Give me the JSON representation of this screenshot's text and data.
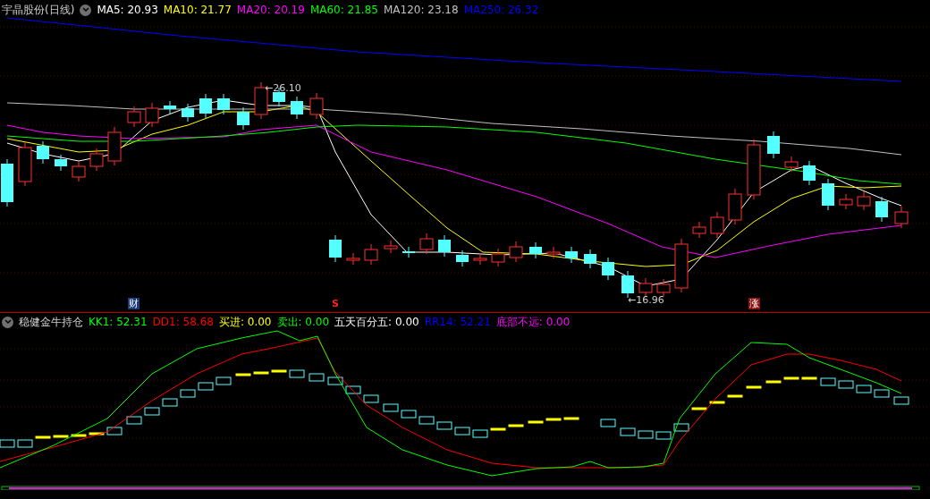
{
  "main_chart": {
    "title": "宇晶股份(日线)",
    "legend": [
      {
        "label": "MA5: 20.93",
        "color": "#ffffff"
      },
      {
        "label": "MA10: 21.77",
        "color": "#ffff00"
      },
      {
        "label": "MA20: 20.19",
        "color": "#ff00ff"
      },
      {
        "label": "MA60: 21.85",
        "color": "#00ff00"
      },
      {
        "label": "MA120: 23.18",
        "color": "#c0c0c0"
      },
      {
        "label": "MA250: 26.32",
        "color": "#0000ff"
      }
    ],
    "high_label": "←26.10",
    "low_label": "←16.96",
    "markers": [
      {
        "text": "财",
        "kind": "finance"
      },
      {
        "text": "S",
        "kind": "signal"
      },
      {
        "text": "涨",
        "kind": "limit"
      }
    ]
  },
  "indicator": {
    "title": "稳健金牛持仓",
    "legend": [
      {
        "label": "KK1: 52.31",
        "color": "#00ff00"
      },
      {
        "label": "DD1: 58.68",
        "color": "#ff0000"
      },
      {
        "label": "买进: 0.00",
        "color": "#ffff00"
      },
      {
        "label": "卖出: 0.00",
        "color": "#00ff00"
      },
      {
        "label": "五天百分五: 0.00",
        "color": "#ffffff"
      },
      {
        "label": "RR14: 52.21",
        "color": "#0000ff"
      },
      {
        "label": "底部不远: 0.00",
        "color": "#ff00ff"
      }
    ]
  }
}
